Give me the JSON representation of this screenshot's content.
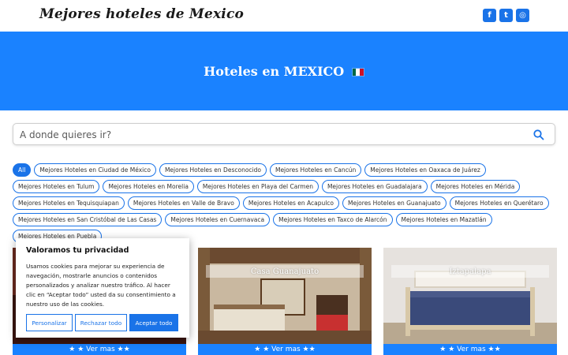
{
  "site": {
    "title": "Mejores hoteles de Mexico"
  },
  "socials": [
    {
      "icon": "facebook-icon",
      "glyph": "f"
    },
    {
      "icon": "twitter-icon",
      "glyph": "t"
    },
    {
      "icon": "instagram-icon",
      "glyph": "◎"
    }
  ],
  "hero": {
    "title": "Hoteles en MEXICO"
  },
  "search": {
    "placeholder": "A donde quieres ir?",
    "value": ""
  },
  "filters": [
    "All",
    "Mejores Hoteles en Ciudad de México",
    "Mejores Hoteles en Desconocido",
    "Mejores Hoteles en Cancún",
    "Mejores Hoteles en Oaxaca de Juárez",
    "Mejores Hoteles en Tulum",
    "Mejores Hoteles en Morelia",
    "Mejores Hoteles en Playa del Carmen",
    "Mejores Hoteles en Guadalajara",
    "Mejores Hoteles en Mérida",
    "Mejores Hoteles en Tequisquiapan",
    "Mejores Hoteles en Valle de Bravo",
    "Mejores Hoteles en Acapulco",
    "Mejores Hoteles en Guanajuato",
    "Mejores Hoteles en Querétaro",
    "Mejores Hoteles en San Cristóbal de Las Casas",
    "Mejores Hoteles en Cuernavaca",
    "Mejores Hoteles en Taxco de Alarcón",
    "Mejores Hoteles en Mazatlán",
    "Mejores Hoteles en Puebla"
  ],
  "cards": [
    {
      "name": "",
      "button": "★ ★ Ver mas ★★"
    },
    {
      "name": "Casa Guanajuato",
      "button": "★ ★ Ver mas ★★"
    },
    {
      "name": "Iztapalapa",
      "button": "★ ★ Ver mas ★★"
    }
  ],
  "cookie": {
    "title": "Valoramos tu privacidad",
    "text": "Usamos cookies para mejorar su experiencia de navegación, mostrarle anuncios o contenidos personalizados y analizar nuestro tráfico. Al hacer clic en “Aceptar todo” usted da su consentimiento a nuestro uso de las cookies.",
    "customize": "Personalizar",
    "reject": "Rechazar todo",
    "accept": "Aceptar todo"
  },
  "colors": {
    "accent": "#1a82ff",
    "chip_border": "#1a73e8"
  }
}
